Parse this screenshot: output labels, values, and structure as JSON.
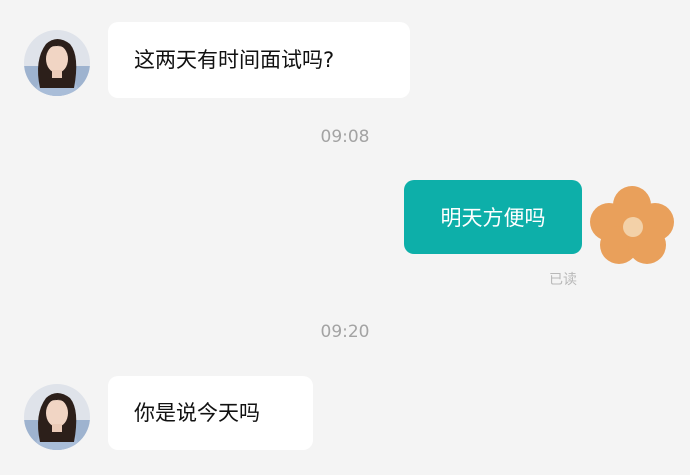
{
  "chat": {
    "messages": [
      {
        "sender": "contact",
        "text": "这两天有时间面试吗?"
      },
      {
        "timestamp": "09:08"
      },
      {
        "sender": "me",
        "text": "明天方便吗",
        "status": "已读"
      },
      {
        "timestamp": "09:20"
      },
      {
        "sender": "contact",
        "text": "你是说今天吗"
      }
    ]
  },
  "colors": {
    "background": "#f4f4f4",
    "outgoing_bubble": "#0dafa9",
    "incoming_bubble": "#ffffff",
    "my_avatar_flower": "#e9a05b"
  },
  "icons": {
    "contact_avatar": "woman-portrait-avatar",
    "my_avatar": "orange-flower-avatar"
  }
}
